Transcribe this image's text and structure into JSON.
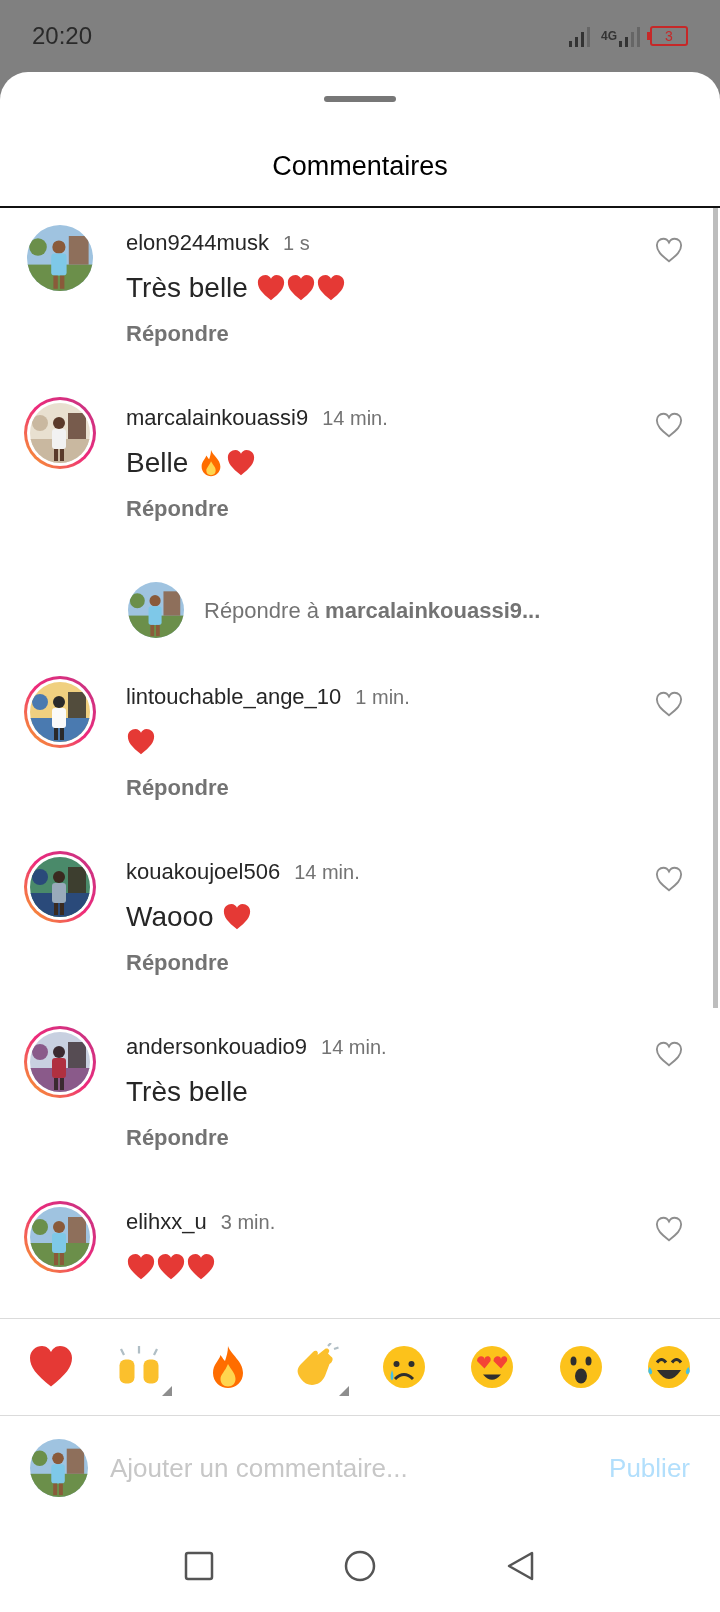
{
  "status_bar": {
    "time": "20:20",
    "network": "4G",
    "battery": "3"
  },
  "sheet": {
    "title": "Commentaires"
  },
  "comments": [
    {
      "kind": "comment",
      "username": "elon9244musk",
      "time": "1 s",
      "text": "Très belle",
      "emojis": [
        {
          "kind": "heart"
        },
        {
          "kind": "heart"
        },
        {
          "kind": "heart"
        }
      ],
      "story_ring": false,
      "reply_label": "Répondre"
    },
    {
      "kind": "comment",
      "username": "marcalainkouassi9",
      "time": "14 min.",
      "text": "Belle",
      "emojis": [
        {
          "kind": "fire"
        },
        {
          "kind": "heart"
        }
      ],
      "story_ring": true,
      "reply_label": "Répondre"
    },
    {
      "kind": "reply_prompt",
      "prefix": "Répondre à",
      "target": "marcalainkouassi9..."
    },
    {
      "kind": "comment",
      "username": "lintouchable_ange_10",
      "time": "1 min.",
      "emojis": [
        {
          "kind": "heart"
        }
      ],
      "story_ring": true,
      "reply_label": "Répondre"
    },
    {
      "kind": "comment",
      "username": "kouakoujoel506",
      "time": "14 min.",
      "text": "Waooo",
      "emojis": [
        {
          "kind": "heart"
        }
      ],
      "story_ring": true,
      "reply_label": "Répondre"
    },
    {
      "kind": "comment",
      "username": "andersonkouadio9",
      "time": "14 min.",
      "text": "Très belle",
      "story_ring": true,
      "reply_label": "Répondre"
    },
    {
      "kind": "comment",
      "username": "elihxx_u",
      "time": "3 min.",
      "emojis": [
        {
          "kind": "heart"
        },
        {
          "kind": "heart"
        },
        {
          "kind": "heart"
        }
      ],
      "story_ring": true
    }
  ],
  "emoji_bar": [
    {
      "kind": "heart",
      "variants": false
    },
    {
      "kind": "raised-hands",
      "variants": true
    },
    {
      "kind": "fire",
      "variants": false
    },
    {
      "kind": "clap",
      "variants": true
    },
    {
      "kind": "crying",
      "variants": false
    },
    {
      "kind": "heart-eyes",
      "variants": false
    },
    {
      "kind": "surprised",
      "variants": false
    },
    {
      "kind": "laughing",
      "variants": false
    }
  ],
  "composer": {
    "placeholder": "Ajouter un commentaire...",
    "publish": "Publier",
    "publish_disabled": true
  }
}
